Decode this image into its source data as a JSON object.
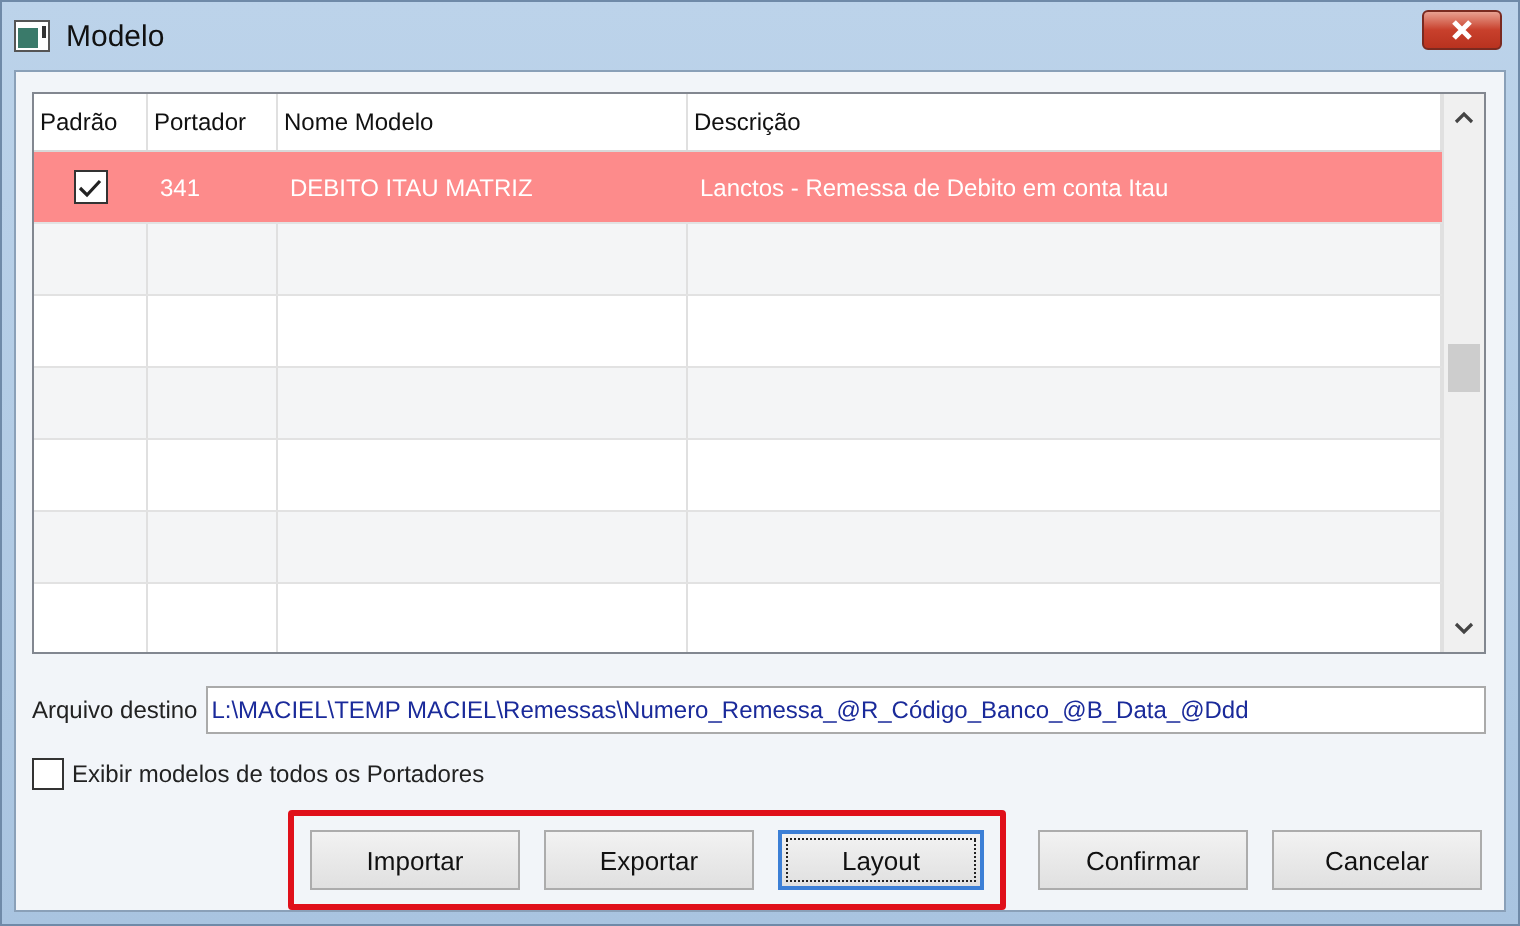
{
  "window": {
    "title": "Modelo"
  },
  "table": {
    "columns": [
      "Padrão",
      "Portador",
      "Nome Modelo",
      "Descrição"
    ],
    "rows": [
      {
        "checked": true,
        "selected": true,
        "portador": "341",
        "nome_modelo": "DEBITO ITAU MATRIZ",
        "descricao": "Lanctos - Remessa de Debito em conta Itau"
      }
    ]
  },
  "arquivo_destino": {
    "label": "Arquivo destino",
    "value": "L:\\MACIEL\\TEMP MACIEL\\Remessas\\Numero_Remessa_@R_Código_Banco_@B_Data_@Ddd"
  },
  "show_all": {
    "label": "Exibir modelos de todos os Portadores",
    "checked": false
  },
  "highlight_frame": {
    "buttons": [
      {
        "label": "Importar",
        "focused": false
      },
      {
        "label": "Exportar",
        "focused": false
      },
      {
        "label": "Layout",
        "focused": true
      }
    ]
  },
  "buttons": [
    {
      "label": "Confirmar",
      "focused": false
    },
    {
      "label": "Cancelar",
      "focused": false
    }
  ]
}
